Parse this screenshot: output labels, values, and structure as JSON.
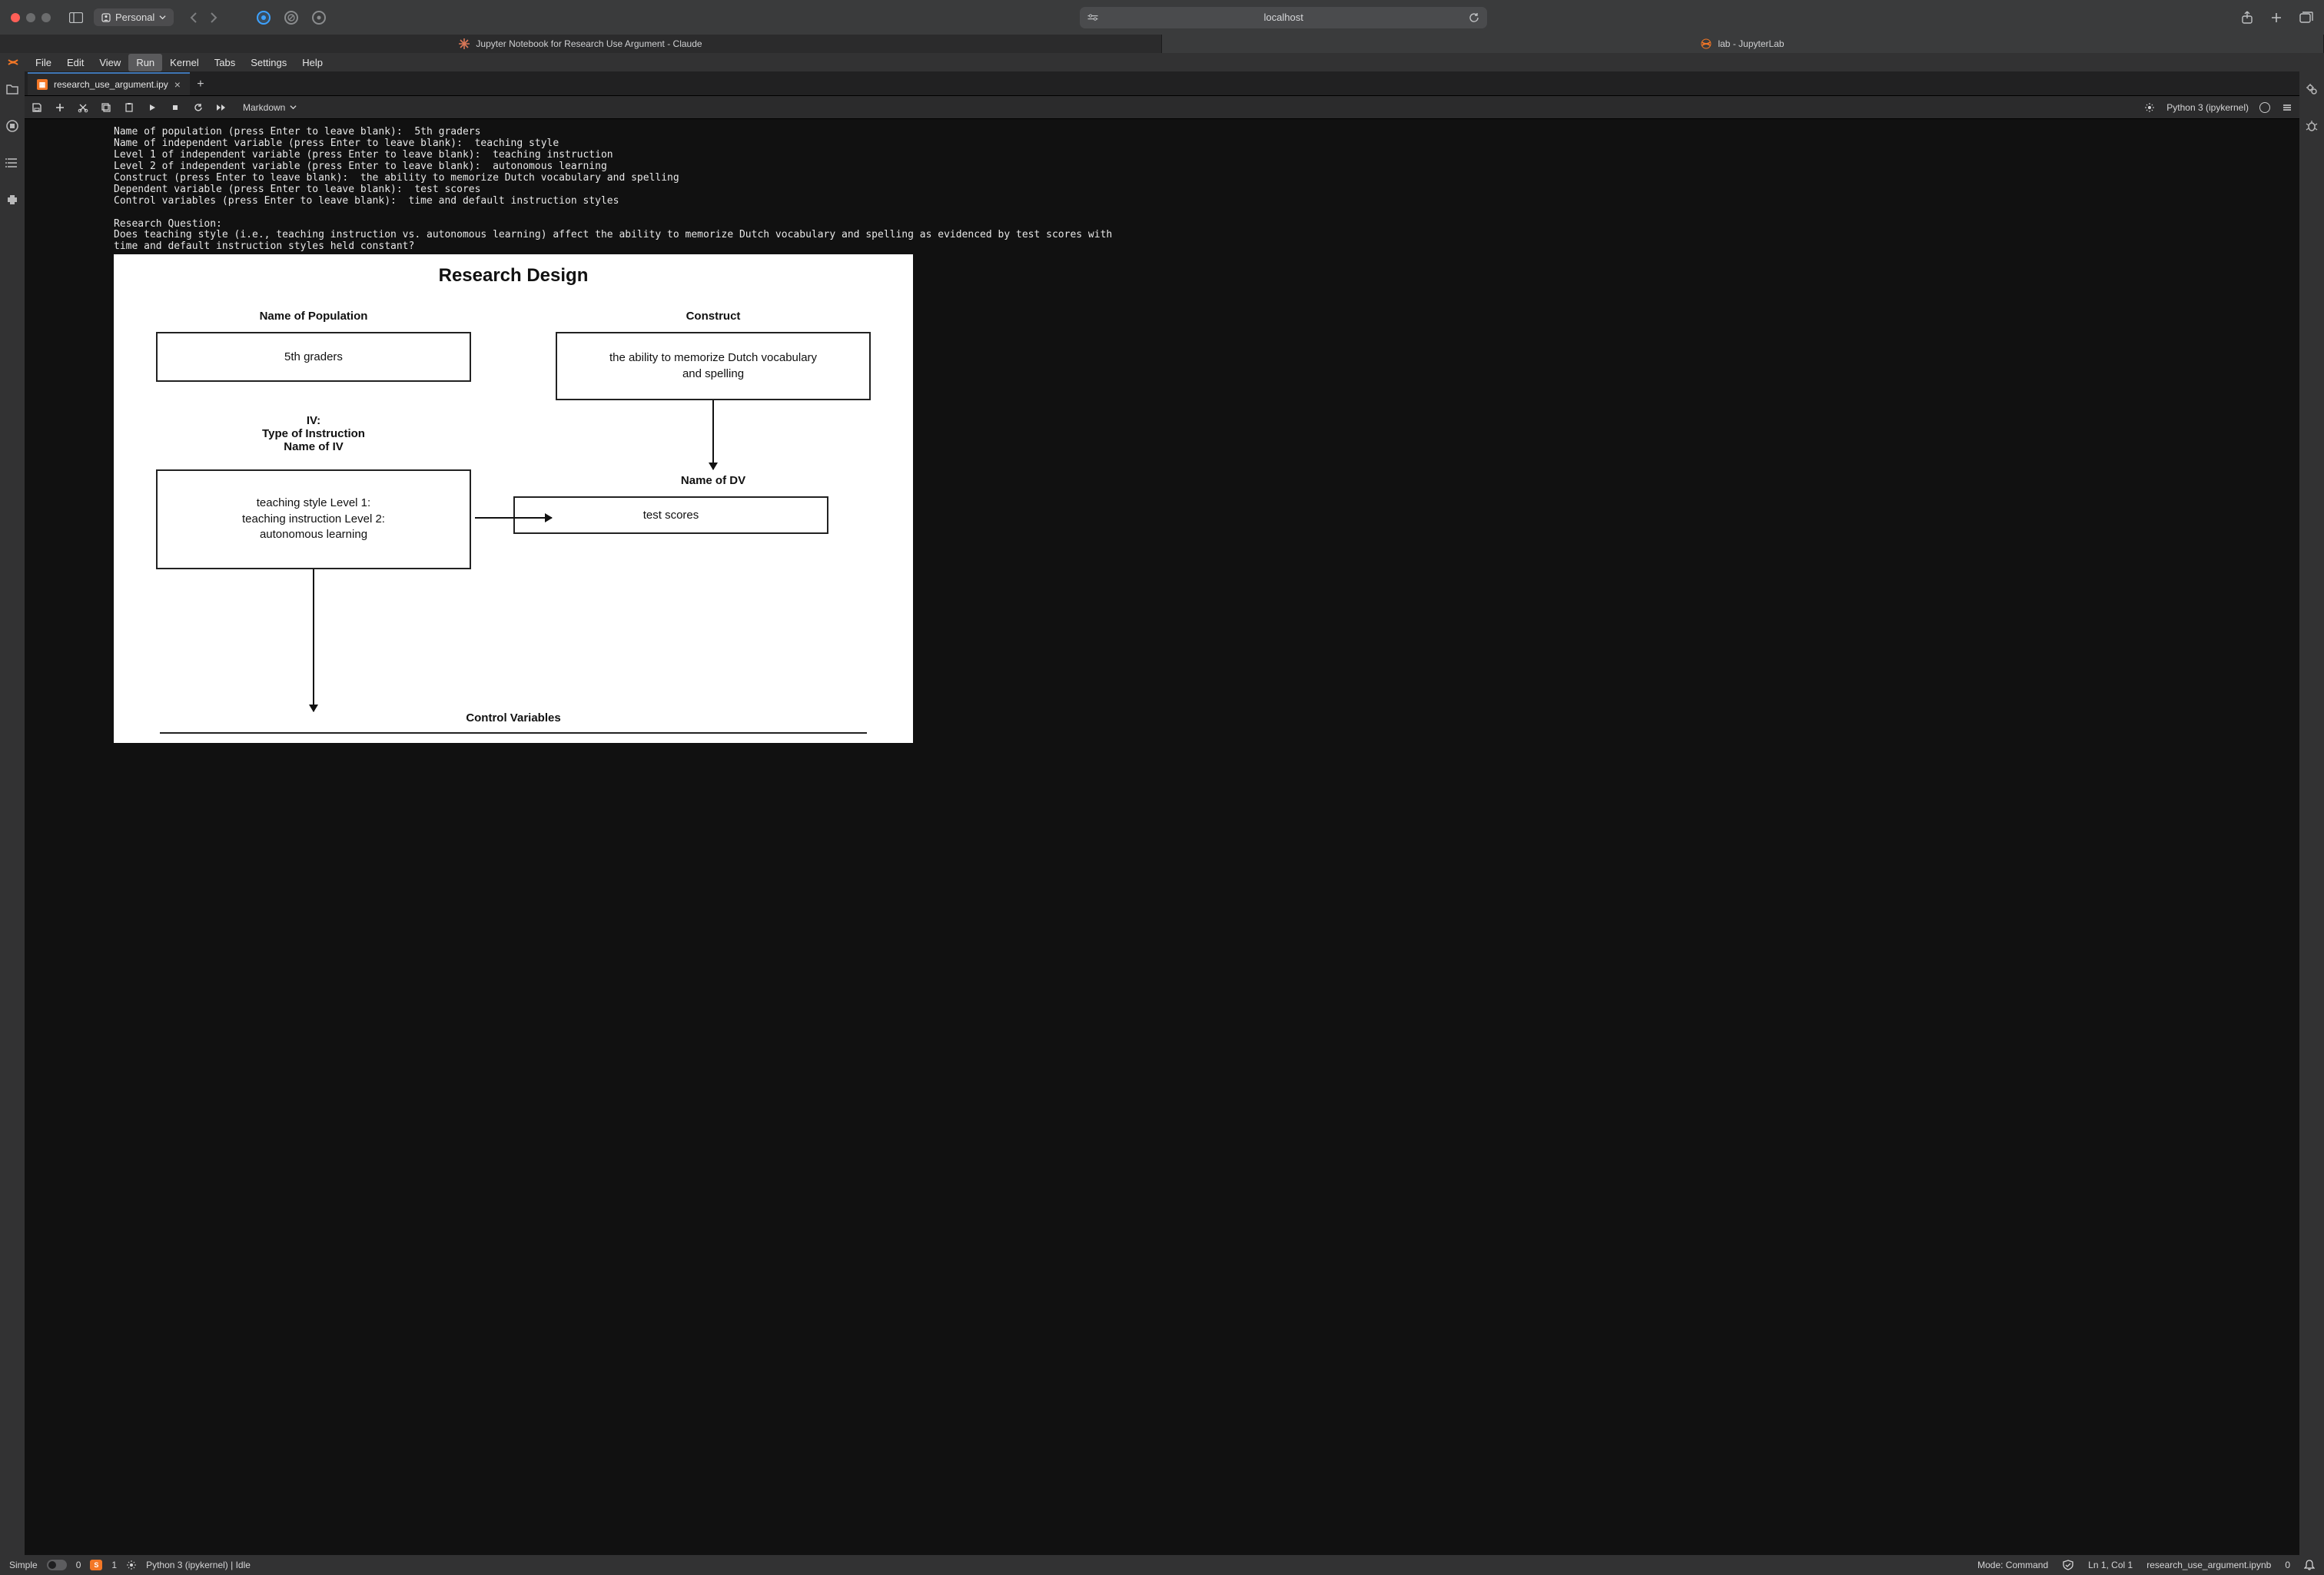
{
  "window": {
    "profile_label": "Personal",
    "address": "localhost"
  },
  "browser_tabs": [
    {
      "label": "Jupyter Notebook for Research Use Argument - Claude",
      "icon": "claude",
      "active": false
    },
    {
      "label": "lab - JupyterLab",
      "icon": "jupyter",
      "active": true
    }
  ],
  "menubar": [
    "File",
    "Edit",
    "View",
    "Run",
    "Kernel",
    "Tabs",
    "Settings",
    "Help"
  ],
  "menubar_selected_index": 3,
  "doc_tab": {
    "label": "research_use_argument.ipy"
  },
  "toolbar": {
    "celltype": "Markdown",
    "kernel_label": "Python 3 (ipykernel)"
  },
  "cell_output_lines": [
    "Name of population (press Enter to leave blank):  5th graders",
    "Name of independent variable (press Enter to leave blank):  teaching style",
    "Level 1 of independent variable (press Enter to leave blank):  teaching instruction",
    "Level 2 of independent variable (press Enter to leave blank):  autonomous learning",
    "Construct (press Enter to leave blank):  the ability to memorize Dutch vocabulary and spelling",
    "Dependent variable (press Enter to leave blank):  test scores",
    "Control variables (press Enter to leave blank):  time and default instruction styles",
    "",
    "Research Question:",
    "Does teaching style (i.e., teaching instruction vs. autonomous learning) affect the ability to memorize Dutch vocabulary and spelling as evidenced by test scores with",
    "time and default instruction styles held constant?"
  ],
  "diagram": {
    "title": "Research Design",
    "population_label": "Name of Population",
    "population_value": "5th graders",
    "construct_label": "Construct",
    "construct_value": "the ability to memorize Dutch vocabulary\nand spelling",
    "iv_label_line1": "IV:",
    "iv_label_line2": "Type of Instruction",
    "iv_label_line3": "Name of IV",
    "iv_value": "teaching style  Level 1:\nteaching instruction Level 2:\nautonomous learning",
    "dv_label": "Name of DV",
    "dv_value": "test scores",
    "control_label": "Control Variables"
  },
  "statusbar": {
    "simple": "Simple",
    "count0": "0",
    "count1": "1",
    "kernel": "Python 3 (ipykernel) | Idle",
    "mode": "Mode: Command",
    "cursor": "Ln 1, Col 1",
    "filename": "research_use_argument.ipynb",
    "notif_count": "0"
  }
}
